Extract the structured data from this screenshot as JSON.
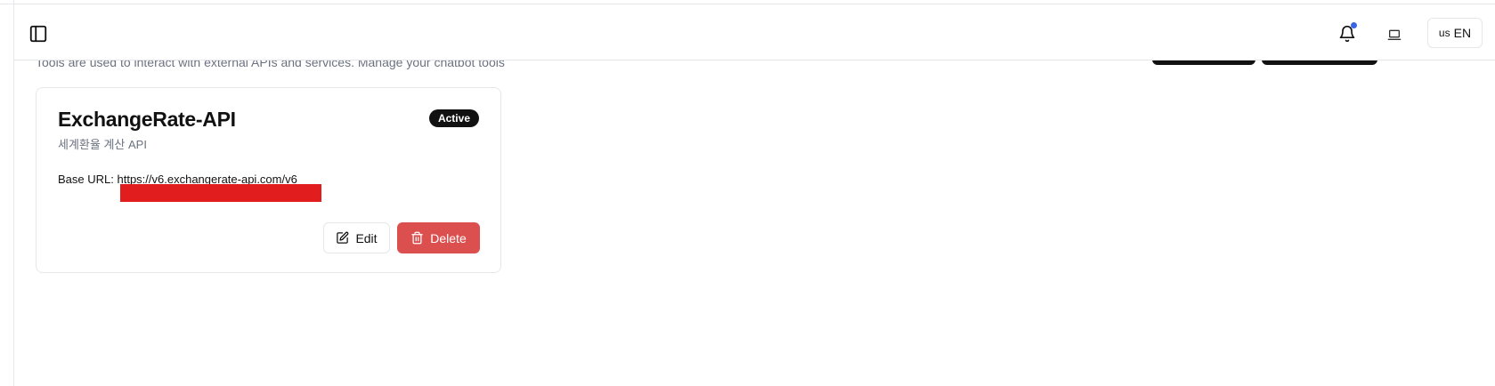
{
  "header": {
    "sidebar_toggle_icon": "sidebar-panel-icon",
    "notification_icon": "bell-icon",
    "notification_dot_color": "#3b63e5",
    "device_icon": "laptop-icon",
    "language": {
      "flag": "us",
      "code": "EN"
    }
  },
  "page": {
    "subtitle": "Tools are used to interact with external APIs and services. Manage your chatbot tools"
  },
  "tool": {
    "name": "ExchangeRate-API",
    "description": "세계환율 계산 API",
    "status": "Active",
    "base_url_label": "Base URL:",
    "base_url_value": "https://v6.exchangerate-api.com/v6",
    "edit_label": "Edit",
    "delete_label": "Delete",
    "edit_icon": "edit-icon",
    "delete_icon": "trash-icon",
    "delete_color": "#dc4f4f"
  }
}
